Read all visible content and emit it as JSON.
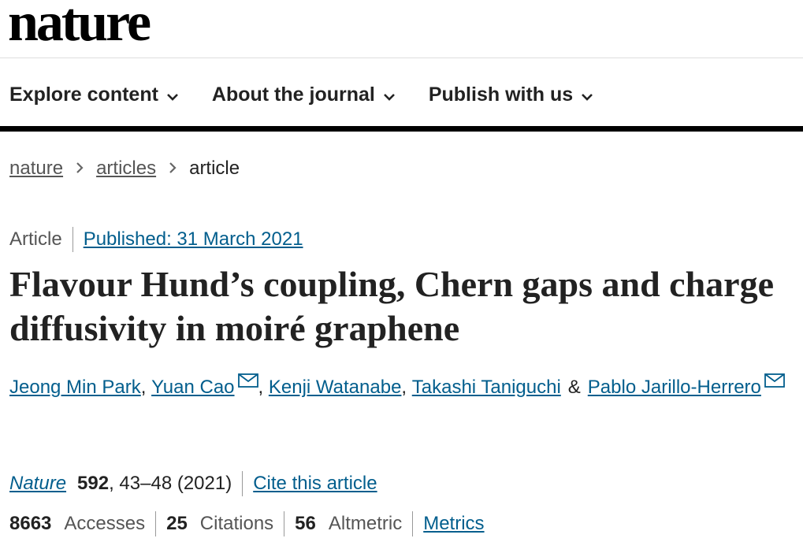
{
  "site": {
    "logo": "nature"
  },
  "nav": {
    "items": [
      {
        "label": "Explore content"
      },
      {
        "label": "About the journal"
      },
      {
        "label": "Publish with us"
      }
    ]
  },
  "breadcrumb": {
    "items": [
      "nature",
      "articles",
      "article"
    ]
  },
  "article": {
    "type": "Article",
    "published": "Published: 31 March 2021",
    "title": "Flavour Hund’s coupling, Chern gaps and charge diffusivity in moiré graphene",
    "authors": [
      {
        "name": "Jeong Min Park",
        "email_icon": false
      },
      {
        "name": "Yuan Cao",
        "email_icon": true
      },
      {
        "name": "Kenji Watanabe",
        "email_icon": false
      },
      {
        "name": "Takashi Taniguchi",
        "email_icon": false
      },
      {
        "name": "Pablo Jarillo-Herrero",
        "email_icon": true
      }
    ],
    "author_separator": ",",
    "author_last_separator": "&",
    "icons": {
      "email": "mail-icon",
      "nav": "chevron-down-icon",
      "breadcrumb": "chevron-right-icon"
    }
  },
  "citation": {
    "journal": "Nature",
    "volume": "592",
    "pages_year": ", 43–48 (2021)",
    "cite_link": "Cite this article"
  },
  "metrics": {
    "accesses_count": "8663",
    "accesses_label": "Accesses",
    "citations_count": "25",
    "citations_label": "Citations",
    "altmetric_count": "56",
    "altmetric_label": "Altmetric",
    "metrics_link": "Metrics"
  },
  "colors": {
    "link": "#025e8d",
    "text": "#222222",
    "muted": "#555555",
    "rule": "#000000"
  }
}
